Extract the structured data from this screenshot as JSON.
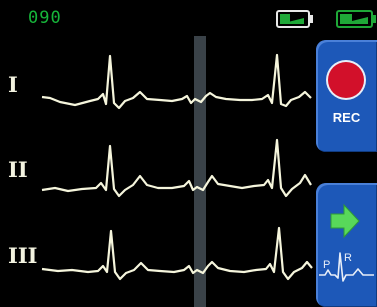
{
  "status": {
    "heart_rate": "090",
    "battery_device_icon": "battery-icon",
    "battery_main_icon": "battery-icon"
  },
  "leads": [
    {
      "label": "I"
    },
    {
      "label": "II"
    },
    {
      "label": "III"
    }
  ],
  "buttons": {
    "record": {
      "label": "REC",
      "icon": "record-icon"
    },
    "next": {
      "icon": "arrow-right-icon",
      "diagram_labels": [
        "P",
        "R"
      ]
    }
  },
  "colors": {
    "background": "#000000",
    "trace": "#f5f5dc",
    "heart_rate": "#16b53a",
    "battery": "#1fa838",
    "button": "#1d58b8",
    "record": "#d2102a",
    "cursor": "#3a4248"
  }
}
